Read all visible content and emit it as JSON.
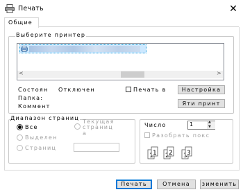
{
  "window": {
    "title": "Печать",
    "close_glyph": "✕",
    "title_icon": "printer-icon"
  },
  "tabs": [
    {
      "label": "Общие",
      "selected": true
    }
  ],
  "printer_select": {
    "group_label": "Выберите принтер",
    "selected_item_icon": "printer-icon",
    "scroll_left": "<",
    "scroll_right": ">"
  },
  "printer_info": {
    "status_label": "Состоян",
    "status_value": "Отключен",
    "location_label": "Папка:",
    "comment_label": "Коммент",
    "print_to_file_label": "Печать в",
    "print_to_file_checked": false,
    "settings_button": "Настройка",
    "find_printer_button": "Яти принт"
  },
  "page_range": {
    "group_label": "Диапазон страниц",
    "options": [
      {
        "label": "Все",
        "selected": true,
        "enabled": true
      },
      {
        "label": "Выделен",
        "selected": false,
        "enabled": false
      },
      {
        "label": "Страниц",
        "selected": false,
        "enabled": false
      }
    ],
    "current_page_label": "Текущая страниц",
    "current_page_suffix": "а",
    "pages_input_value": ""
  },
  "copies": {
    "count_label": "Число",
    "count_value": "1",
    "collate_label": "Разобрать покс",
    "collate_checked": false,
    "collate_enabled": false,
    "pages_illustration": "collate-pages-icon"
  },
  "footer": {
    "print_button": "Печать",
    "cancel_button": "Отмена",
    "apply_button": "Применить",
    "apply_button_visible_text": "зименить"
  },
  "colors": {
    "selection_bg": "#cce8ff",
    "default_button_border": "#0078d7",
    "button_bg": "#e1e1e1",
    "disabled_text": "#a0a0a0"
  }
}
